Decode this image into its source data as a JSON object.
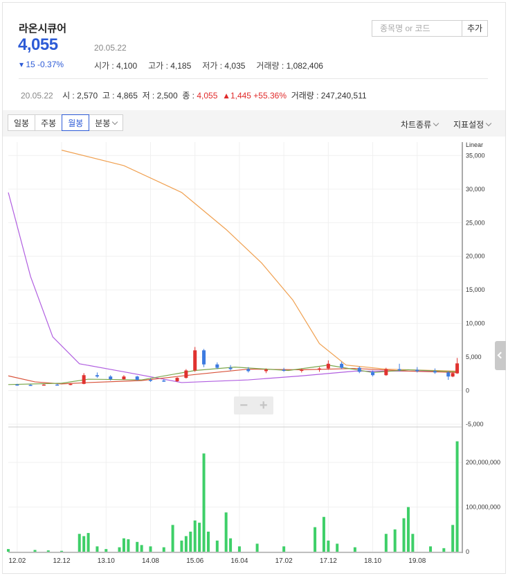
{
  "stock": {
    "name": "라온시큐어",
    "price": "4,055",
    "change": "▾ 15 -0.37%",
    "date": "20.05.22",
    "ohlc": [
      {
        "label": "시가",
        "value": "4,100"
      },
      {
        "label": "고가",
        "value": "4,185"
      },
      {
        "label": "저가",
        "value": "4,035"
      },
      {
        "label": "거래량",
        "value": "1,082,406"
      }
    ]
  },
  "search": {
    "placeholder": "종목명 or 코드",
    "add_label": "추가"
  },
  "summary": {
    "date": "20.05.22",
    "open": "시 : 2,570",
    "high": "고 : 4,865",
    "low": "저 : 2,500",
    "close_label": "종 : ",
    "close_value": "4,055",
    "change": "▲1,445 +55.36%",
    "volume": "거래량 : 247,240,511"
  },
  "toolbar": {
    "tabs": [
      {
        "label": "일봉",
        "active": false
      },
      {
        "label": "주봉",
        "active": false
      },
      {
        "label": "월봉",
        "active": true
      },
      {
        "label": "분봉",
        "active": false
      }
    ],
    "chart_type": "차트종류",
    "indicator": "지표설정"
  },
  "zoom": {
    "minus": "−",
    "plus": "+"
  },
  "colors": {
    "up": "#e0322f",
    "down": "#3d7be0",
    "ma_purple": "#b05ee0",
    "ma_orange": "#f0a050",
    "ma_red": "#d9533b",
    "ma_green": "#7aa64a",
    "volume": "#3ecf68",
    "accent": "#2d5bd6"
  },
  "chart_data": [
    {
      "type": "candlestick",
      "title": "",
      "scale_label": "Linear",
      "ylim": [
        -5000,
        37000
      ],
      "y_ticks": [
        "35,000",
        "30,000",
        "25,000",
        "20,000",
        "15,000",
        "10,000",
        "5,000",
        "0",
        "-5,000"
      ],
      "x_ticks": [
        "12.02",
        "12.12",
        "13.10",
        "14.08",
        "15.06",
        "16.04",
        "17.02",
        "17.12",
        "18.10",
        "19.08"
      ],
      "x_range": [
        "2011.12",
        "2020.05"
      ],
      "grid": true,
      "ohlc": [
        {
          "x": "2012.02",
          "o": 900,
          "h": 1000,
          "l": 800,
          "c": 850
        },
        {
          "x": "2012.05",
          "o": 850,
          "h": 950,
          "l": 750,
          "c": 800
        },
        {
          "x": "2012.08",
          "o": 800,
          "h": 950,
          "l": 750,
          "c": 900
        },
        {
          "x": "2012.11",
          "o": 900,
          "h": 1000,
          "l": 800,
          "c": 850
        },
        {
          "x": "2013.02",
          "o": 850,
          "h": 1100,
          "l": 800,
          "c": 1000
        },
        {
          "x": "2013.05",
          "o": 1000,
          "h": 2600,
          "l": 950,
          "c": 2300
        },
        {
          "x": "2013.08",
          "o": 2300,
          "h": 2700,
          "l": 1900,
          "c": 2100
        },
        {
          "x": "2013.11",
          "o": 2100,
          "h": 2300,
          "l": 1500,
          "c": 1700
        },
        {
          "x": "2014.02",
          "o": 1700,
          "h": 2300,
          "l": 1600,
          "c": 2100
        },
        {
          "x": "2014.05",
          "o": 2100,
          "h": 2200,
          "l": 1500,
          "c": 1600
        },
        {
          "x": "2014.08",
          "o": 1600,
          "h": 1800,
          "l": 1300,
          "c": 1500
        },
        {
          "x": "2014.11",
          "o": 1500,
          "h": 1700,
          "l": 1300,
          "c": 1400
        },
        {
          "x": "2015.02",
          "o": 1400,
          "h": 2000,
          "l": 1300,
          "c": 1900
        },
        {
          "x": "2015.04",
          "o": 1900,
          "h": 3200,
          "l": 1800,
          "c": 3000
        },
        {
          "x": "2015.06",
          "o": 3000,
          "h": 6500,
          "l": 2800,
          "c": 6000
        },
        {
          "x": "2015.08",
          "o": 6000,
          "h": 6200,
          "l": 3500,
          "c": 3900
        },
        {
          "x": "2015.11",
          "o": 3900,
          "h": 4200,
          "l": 3200,
          "c": 3400
        },
        {
          "x": "2016.02",
          "o": 3400,
          "h": 3800,
          "l": 3000,
          "c": 3200
        },
        {
          "x": "2016.06",
          "o": 3200,
          "h": 3500,
          "l": 2700,
          "c": 2900
        },
        {
          "x": "2016.10",
          "o": 2900,
          "h": 3300,
          "l": 2600,
          "c": 3100
        },
        {
          "x": "2017.02",
          "o": 3100,
          "h": 3400,
          "l": 2800,
          "c": 3000
        },
        {
          "x": "2017.06",
          "o": 3000,
          "h": 3300,
          "l": 2700,
          "c": 3100
        },
        {
          "x": "2017.10",
          "o": 3100,
          "h": 3500,
          "l": 2800,
          "c": 3300
        },
        {
          "x": "2017.12",
          "o": 3300,
          "h": 4500,
          "l": 3100,
          "c": 4000
        },
        {
          "x": "2018.03",
          "o": 4000,
          "h": 4300,
          "l": 3200,
          "c": 3400
        },
        {
          "x": "2018.07",
          "o": 3400,
          "h": 3600,
          "l": 2600,
          "c": 2800
        },
        {
          "x": "2018.10",
          "o": 2800,
          "h": 3000,
          "l": 2100,
          "c": 2300
        },
        {
          "x": "2019.01",
          "o": 2300,
          "h": 3400,
          "l": 2200,
          "c": 3200
        },
        {
          "x": "2019.04",
          "o": 3200,
          "h": 4000,
          "l": 2900,
          "c": 3100
        },
        {
          "x": "2019.08",
          "o": 3100,
          "h": 3500,
          "l": 2700,
          "c": 2900
        },
        {
          "x": "2019.12",
          "o": 2900,
          "h": 3300,
          "l": 2500,
          "c": 2700
        },
        {
          "x": "2020.03",
          "o": 2700,
          "h": 2900,
          "l": 1600,
          "c": 2100
        },
        {
          "x": "2020.04",
          "o": 2100,
          "h": 2800,
          "l": 2000,
          "c": 2610
        },
        {
          "x": "2020.05",
          "o": 2570,
          "h": 4865,
          "l": 2500,
          "c": 4055
        }
      ],
      "moving_averages": [
        {
          "color": "purple",
          "points": [
            [
              "2011.12",
              29500
            ],
            [
              "2012.05",
              17000
            ],
            [
              "2012.10",
              8000
            ],
            [
              "2013.04",
              4000
            ],
            [
              "2014.02",
              2800
            ],
            [
              "2015.03",
              1200
            ],
            [
              "2016.06",
              1600
            ],
            [
              "2017.06",
              2200
            ],
            [
              "2018.06",
              2900
            ],
            [
              "2020.05",
              2900
            ]
          ]
        },
        {
          "color": "orange",
          "points": [
            [
              "2012.12",
              35800
            ],
            [
              "2014.02",
              33500
            ],
            [
              "2015.03",
              29500
            ],
            [
              "2016.01",
              24000
            ],
            [
              "2016.09",
              19000
            ],
            [
              "2017.04",
              13500
            ],
            [
              "2017.10",
              7000
            ],
            [
              "2018.04",
              3800
            ],
            [
              "2019.01",
              3200
            ],
            [
              "2020.05",
              2900
            ]
          ]
        },
        {
          "color": "red",
          "points": [
            [
              "2011.12",
              2200
            ],
            [
              "2012.06",
              1300
            ],
            [
              "2012.12",
              1000
            ],
            [
              "2013.06",
              1200
            ],
            [
              "2014.06",
              1500
            ],
            [
              "2015.06",
              2400
            ],
            [
              "2016.06",
              3200
            ],
            [
              "2017.06",
              3100
            ],
            [
              "2018.06",
              3300
            ],
            [
              "2019.06",
              2900
            ],
            [
              "2020.05",
              2700
            ]
          ]
        },
        {
          "color": "green",
          "points": [
            [
              "2011.12",
              900
            ],
            [
              "2012.12",
              1100
            ],
            [
              "2013.06",
              1700
            ],
            [
              "2014.06",
              1600
            ],
            [
              "2015.06",
              3000
            ],
            [
              "2016.03",
              3500
            ],
            [
              "2017.03",
              3000
            ],
            [
              "2017.12",
              3800
            ],
            [
              "2018.10",
              2700
            ],
            [
              "2019.06",
              3100
            ],
            [
              "2020.05",
              2800
            ]
          ]
        }
      ]
    },
    {
      "type": "bar",
      "title": "",
      "ylim": [
        0,
        270000000
      ],
      "y_ticks": [
        "200,000,000",
        "100,000,000",
        "0"
      ],
      "volume": [
        {
          "x": "2011.12",
          "v": 6000000
        },
        {
          "x": "2012.06",
          "v": 4000000
        },
        {
          "x": "2012.09",
          "v": 3000000
        },
        {
          "x": "2012.12",
          "v": 2000000
        },
        {
          "x": "2013.04",
          "v": 40000000
        },
        {
          "x": "2013.05",
          "v": 35000000
        },
        {
          "x": "2013.06",
          "v": 42000000
        },
        {
          "x": "2013.08",
          "v": 12000000
        },
        {
          "x": "2013.10",
          "v": 6000000
        },
        {
          "x": "2014.01",
          "v": 10000000
        },
        {
          "x": "2014.02",
          "v": 30000000
        },
        {
          "x": "2014.03",
          "v": 28000000
        },
        {
          "x": "2014.05",
          "v": 22000000
        },
        {
          "x": "2014.06",
          "v": 15000000
        },
        {
          "x": "2014.08",
          "v": 12000000
        },
        {
          "x": "2014.11",
          "v": 10000000
        },
        {
          "x": "2015.01",
          "v": 60000000
        },
        {
          "x": "2015.03",
          "v": 25000000
        },
        {
          "x": "2015.04",
          "v": 35000000
        },
        {
          "x": "2015.05",
          "v": 45000000
        },
        {
          "x": "2015.06",
          "v": 70000000
        },
        {
          "x": "2015.07",
          "v": 65000000
        },
        {
          "x": "2015.08",
          "v": 220000000
        },
        {
          "x": "2015.09",
          "v": 45000000
        },
        {
          "x": "2015.11",
          "v": 25000000
        },
        {
          "x": "2016.01",
          "v": 88000000
        },
        {
          "x": "2016.02",
          "v": 30000000
        },
        {
          "x": "2016.04",
          "v": 12000000
        },
        {
          "x": "2016.08",
          "v": 18000000
        },
        {
          "x": "2017.02",
          "v": 12000000
        },
        {
          "x": "2017.09",
          "v": 55000000
        },
        {
          "x": "2017.11",
          "v": 78000000
        },
        {
          "x": "2017.12",
          "v": 25000000
        },
        {
          "x": "2018.02",
          "v": 18000000
        },
        {
          "x": "2018.06",
          "v": 10000000
        },
        {
          "x": "2019.01",
          "v": 40000000
        },
        {
          "x": "2019.03",
          "v": 50000000
        },
        {
          "x": "2019.05",
          "v": 75000000
        },
        {
          "x": "2019.06",
          "v": 100000000
        },
        {
          "x": "2019.07",
          "v": 40000000
        },
        {
          "x": "2019.11",
          "v": 12000000
        },
        {
          "x": "2020.02",
          "v": 8000000
        },
        {
          "x": "2020.04",
          "v": 60000000
        },
        {
          "x": "2020.05",
          "v": 247240511
        }
      ]
    }
  ]
}
